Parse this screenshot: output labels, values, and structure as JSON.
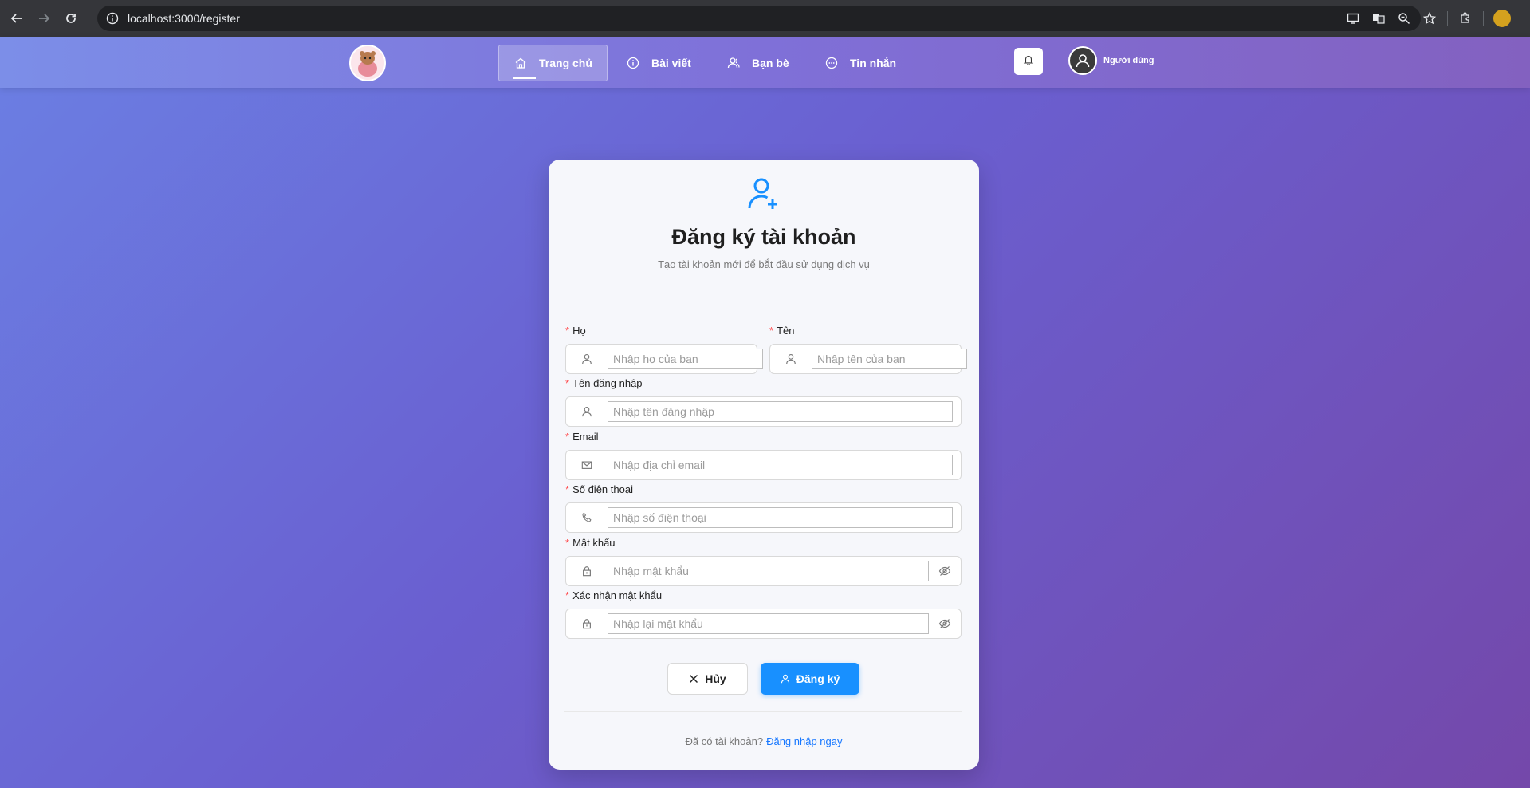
{
  "browser": {
    "url": "localhost:3000/register",
    "icons": [
      "back-icon",
      "forward-icon",
      "reload-icon",
      "site-info-icon",
      "cast-icon",
      "translate-icon",
      "zoom-icon",
      "bookmark-star-icon",
      "extensions-icon",
      "profile-avatar"
    ]
  },
  "nav": {
    "items": [
      {
        "label": "Trang chủ",
        "icon": "home-icon",
        "active": true
      },
      {
        "label": "Bài viết",
        "icon": "info-icon",
        "active": false
      },
      {
        "label": "Bạn bè",
        "icon": "friends-icon",
        "active": false
      },
      {
        "label": "Tin nhắn",
        "icon": "message-icon",
        "active": false
      }
    ],
    "user_label": "Người dùng"
  },
  "form": {
    "title": "Đăng ký tài khoản",
    "subtitle": "Tạo tài khoản mới để bắt đầu sử dụng dịch vụ",
    "fields": {
      "last_name": {
        "label": "Họ",
        "placeholder": "Nhập họ của bạn"
      },
      "first_name": {
        "label": "Tên",
        "placeholder": "Nhập tên của bạn"
      },
      "username": {
        "label": "Tên đăng nhập",
        "placeholder": "Nhập tên đăng nhập"
      },
      "email": {
        "label": "Email",
        "placeholder": "Nhập địa chỉ email"
      },
      "phone": {
        "label": "Số điện thoại",
        "placeholder": "Nhập số điện thoại"
      },
      "password": {
        "label": "Mật khẩu",
        "placeholder": "Nhập mật khẩu"
      },
      "confirm_password": {
        "label": "Xác nhận mật khẩu",
        "placeholder": "Nhập lại mật khẩu"
      }
    },
    "required_mark": "*",
    "cancel_label": "Hủy",
    "submit_label": "Đăng ký",
    "footer_text": "Đã có tài khoản?",
    "footer_link": "Đăng nhập ngay"
  },
  "colors": {
    "primary": "#1890ff",
    "required": "#ff4d4f",
    "link": "#1677ff"
  }
}
